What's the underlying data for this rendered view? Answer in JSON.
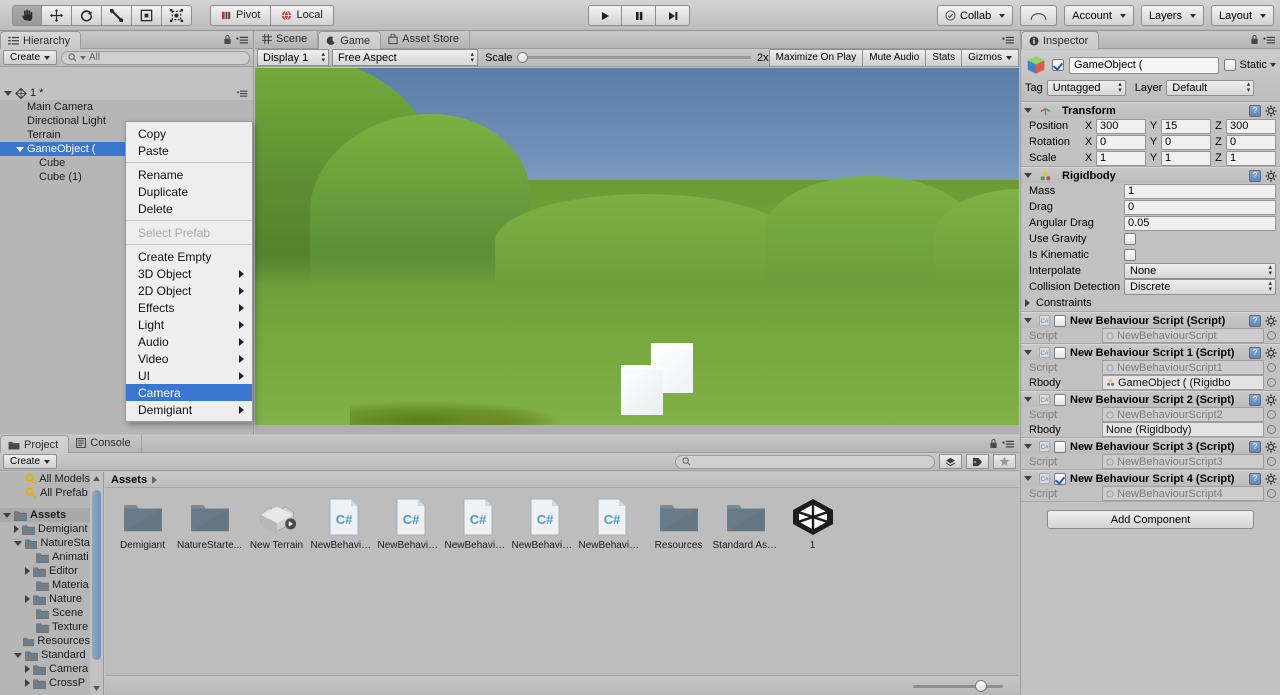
{
  "toolbar": {
    "tools": [
      {
        "name": "hand-tool",
        "label": "Hand"
      },
      {
        "name": "move-tool",
        "label": "Move"
      },
      {
        "name": "rotate-tool",
        "label": "Rotate"
      },
      {
        "name": "scale-tool",
        "label": "Scale"
      },
      {
        "name": "rect-tool",
        "label": "Rect"
      },
      {
        "name": "transform-tool",
        "label": "Transform"
      }
    ],
    "pivot_label": "Pivot",
    "local_label": "Local",
    "play_label": "Play",
    "pause_label": "Pause",
    "step_label": "Step",
    "collab_label": "Collab",
    "cloud_label": "Cloud",
    "account_label": "Account",
    "layers_label": "Layers",
    "layout_label": "Layout"
  },
  "hierarchy": {
    "tab_label": "Hierarchy",
    "create_label": "Create",
    "search_placeholder": "All",
    "scene_label": "1 *",
    "items": [
      {
        "label": "Main Camera",
        "indent": 1,
        "expandable": false,
        "selected": false
      },
      {
        "label": "Directional Light",
        "indent": 1,
        "expandable": false,
        "selected": false
      },
      {
        "label": "Terrain",
        "indent": 1,
        "expandable": false,
        "selected": false
      },
      {
        "label": "GameObject (",
        "indent": 1,
        "expandable": true,
        "selected": true
      },
      {
        "label": "Cube",
        "indent": 2,
        "expandable": false,
        "selected": false
      },
      {
        "label": "Cube (1)",
        "indent": 2,
        "expandable": false,
        "selected": false
      }
    ]
  },
  "context_menu": {
    "items": [
      {
        "label": "Copy",
        "submenu": false,
        "disabled": false,
        "selected": false,
        "sep_after": false
      },
      {
        "label": "Paste",
        "submenu": false,
        "disabled": false,
        "selected": false,
        "sep_after": true
      },
      {
        "label": "Rename",
        "submenu": false,
        "disabled": false,
        "selected": false,
        "sep_after": false
      },
      {
        "label": "Duplicate",
        "submenu": false,
        "disabled": false,
        "selected": false,
        "sep_after": false
      },
      {
        "label": "Delete",
        "submenu": false,
        "disabled": false,
        "selected": false,
        "sep_after": true
      },
      {
        "label": "Select Prefab",
        "submenu": false,
        "disabled": true,
        "selected": false,
        "sep_after": true
      },
      {
        "label": "Create Empty",
        "submenu": false,
        "disabled": false,
        "selected": false,
        "sep_after": false
      },
      {
        "label": "3D Object",
        "submenu": true,
        "disabled": false,
        "selected": false,
        "sep_after": false
      },
      {
        "label": "2D Object",
        "submenu": true,
        "disabled": false,
        "selected": false,
        "sep_after": false
      },
      {
        "label": "Effects",
        "submenu": true,
        "disabled": false,
        "selected": false,
        "sep_after": false
      },
      {
        "label": "Light",
        "submenu": true,
        "disabled": false,
        "selected": false,
        "sep_after": false
      },
      {
        "label": "Audio",
        "submenu": true,
        "disabled": false,
        "selected": false,
        "sep_after": false
      },
      {
        "label": "Video",
        "submenu": true,
        "disabled": false,
        "selected": false,
        "sep_after": false
      },
      {
        "label": "UI",
        "submenu": true,
        "disabled": false,
        "selected": false,
        "sep_after": false
      },
      {
        "label": "Camera",
        "submenu": false,
        "disabled": false,
        "selected": true,
        "sep_after": false
      },
      {
        "label": "Demigiant",
        "submenu": true,
        "disabled": false,
        "selected": false,
        "sep_after": false
      }
    ]
  },
  "gameview": {
    "tabs": [
      {
        "label": "Scene",
        "selected": false
      },
      {
        "label": "Game",
        "selected": true
      },
      {
        "label": "Asset Store",
        "selected": false
      }
    ],
    "display_label": "Display 1",
    "aspect_label": "Free Aspect",
    "scale_label": "Scale",
    "scale_value": "2x",
    "maximize_label": "Maximize On Play",
    "mute_label": "Mute Audio",
    "stats_label": "Stats",
    "gizmos_label": "Gizmos"
  },
  "inspector": {
    "tab_label": "Inspector",
    "object_name": "GameObject (",
    "object_enabled": true,
    "static_label": "Static",
    "static_checked": false,
    "tag_label": "Tag",
    "tag_value": "Untagged",
    "layer_label": "Layer",
    "layer_value": "Default",
    "transform": {
      "title": "Transform",
      "rows": [
        {
          "label": "Position",
          "x": "300",
          "y": "15",
          "z": "300"
        },
        {
          "label": "Rotation",
          "x": "0",
          "y": "0",
          "z": "0"
        },
        {
          "label": "Scale",
          "x": "1",
          "y": "1",
          "z": "1"
        }
      ]
    },
    "rigidbody": {
      "title": "Rigidbody",
      "mass_label": "Mass",
      "mass_value": "1",
      "drag_label": "Drag",
      "drag_value": "0",
      "angular_drag_label": "Angular Drag",
      "angular_drag_value": "0.05",
      "use_gravity_label": "Use Gravity",
      "use_gravity_checked": false,
      "is_kinematic_label": "Is Kinematic",
      "is_kinematic_checked": false,
      "interpolate_label": "Interpolate",
      "interpolate_value": "None",
      "collision_label": "Collision Detection",
      "collision_value": "Discrete",
      "constraints_label": "Constraints"
    },
    "scripts": [
      {
        "title": "New Behaviour Script (Script)",
        "enabled": false,
        "script_label": "Script",
        "script_value": "NewBehaviourScript",
        "has_rbody": false,
        "rbody_label": "",
        "rbody_value": "",
        "rbody_active": false
      },
      {
        "title": "New Behaviour Script 1 (Script)",
        "enabled": false,
        "script_label": "Script",
        "script_value": "NewBehaviourScript1",
        "has_rbody": true,
        "rbody_label": "Rbody",
        "rbody_value": "GameObject ( (Rigidbo",
        "rbody_active": true
      },
      {
        "title": "New Behaviour Script 2 (Script)",
        "enabled": false,
        "script_label": "Script",
        "script_value": "NewBehaviourScript2",
        "has_rbody": true,
        "rbody_label": "Rbody",
        "rbody_value": "None (Rigidbody)",
        "rbody_active": true
      },
      {
        "title": "New Behaviour Script 3 (Script)",
        "enabled": false,
        "script_label": "Script",
        "script_value": "NewBehaviourScript3",
        "has_rbody": false,
        "rbody_label": "",
        "rbody_value": "",
        "rbody_active": false
      },
      {
        "title": "New Behaviour Script 4 (Script)",
        "enabled": true,
        "script_label": "Script",
        "script_value": "NewBehaviourScript4",
        "has_rbody": false,
        "rbody_label": "",
        "rbody_value": "",
        "rbody_active": false
      }
    ],
    "add_component_label": "Add Component"
  },
  "project": {
    "tabs": [
      {
        "label": "Project",
        "selected": true
      },
      {
        "label": "Console",
        "selected": false
      }
    ],
    "create_label": "Create",
    "search_placeholder": "",
    "breadcrumb": "Assets",
    "tree": [
      {
        "label": "All Models",
        "indent": 1,
        "kind": "search",
        "expand": "none"
      },
      {
        "label": "All Prefab",
        "indent": 1,
        "kind": "search",
        "expand": "none"
      },
      {
        "label": "",
        "indent": 0,
        "kind": "gap",
        "expand": "none"
      },
      {
        "label": "Assets",
        "indent": 0,
        "kind": "folder",
        "expand": "open",
        "selected": true
      },
      {
        "label": "Demigiant",
        "indent": 1,
        "kind": "folder",
        "expand": "closed"
      },
      {
        "label": "NatureSta",
        "indent": 1,
        "kind": "folder",
        "expand": "open"
      },
      {
        "label": "Animati",
        "indent": 2,
        "kind": "folder",
        "expand": "none"
      },
      {
        "label": "Editor",
        "indent": 2,
        "kind": "folder",
        "expand": "closed"
      },
      {
        "label": "Materia",
        "indent": 2,
        "kind": "folder",
        "expand": "none"
      },
      {
        "label": "Nature",
        "indent": 2,
        "kind": "folder",
        "expand": "closed"
      },
      {
        "label": "Scene",
        "indent": 2,
        "kind": "folder",
        "expand": "none"
      },
      {
        "label": "Texture",
        "indent": 2,
        "kind": "folder",
        "expand": "none"
      },
      {
        "label": "Resources",
        "indent": 1,
        "kind": "folder",
        "expand": "none"
      },
      {
        "label": "Standard ",
        "indent": 1,
        "kind": "folder",
        "expand": "open"
      },
      {
        "label": "Camera",
        "indent": 2,
        "kind": "folder",
        "expand": "closed"
      },
      {
        "label": "CrossP",
        "indent": 2,
        "kind": "folder",
        "expand": "closed"
      }
    ],
    "assets": [
      {
        "label": "Demigiant",
        "icon": "folder"
      },
      {
        "label": "NatureStarte...",
        "icon": "folder"
      },
      {
        "label": "New Terrain",
        "icon": "terrain"
      },
      {
        "label": "NewBehaviou...",
        "icon": "csharp"
      },
      {
        "label": "NewBehaviou...",
        "icon": "csharp"
      },
      {
        "label": "NewBehaviou...",
        "icon": "csharp"
      },
      {
        "label": "NewBehaviou...",
        "icon": "csharp"
      },
      {
        "label": "NewBehaviou...",
        "icon": "csharp"
      },
      {
        "label": "Resources",
        "icon": "folder"
      },
      {
        "label": "Standard Ass...",
        "icon": "folder"
      },
      {
        "label": "1",
        "icon": "unity"
      }
    ]
  },
  "colors": {
    "selection_blue": "#3a77d0",
    "panel_bg": "#c2c2c2",
    "tree_bg": "#b6b6b6",
    "sky_top": "#5b7ea8",
    "ground_green": "#6fa23a"
  }
}
